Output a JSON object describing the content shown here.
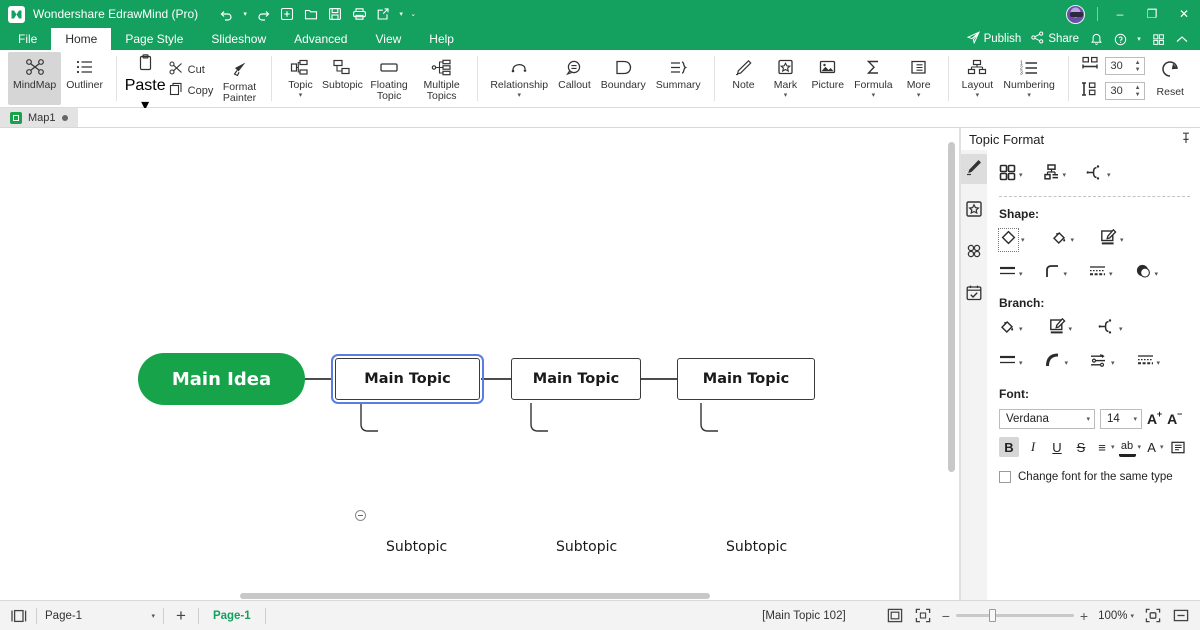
{
  "window": {
    "title": "Wondershare EdrawMind (Pro)",
    "logo_icon": "edrawmind-logo-icon",
    "quick_access": [
      {
        "name": "undo-icon",
        "glyph": "↶",
        "has_caret": true
      },
      {
        "name": "redo-icon",
        "glyph": "↷",
        "has_caret": false
      },
      {
        "name": "new-document-icon",
        "glyph": "⊞",
        "has_caret": false
      },
      {
        "name": "open-folder-icon",
        "glyph": "🗀",
        "has_caret": false
      },
      {
        "name": "save-icon",
        "glyph": "🖫",
        "has_caret": false
      },
      {
        "name": "print-icon",
        "glyph": "⎙",
        "has_caret": false
      },
      {
        "name": "export-icon",
        "glyph": "↗",
        "has_caret": true
      }
    ],
    "more_commands": "⌄",
    "minimize": "–",
    "maximize": "❐",
    "close": "✕"
  },
  "menubar": {
    "items": [
      {
        "label": "File",
        "active": false
      },
      {
        "label": "Home",
        "active": true
      },
      {
        "label": "Page Style",
        "active": false
      },
      {
        "label": "Slideshow",
        "active": false
      },
      {
        "label": "Advanced",
        "active": false
      },
      {
        "label": "View",
        "active": false
      },
      {
        "label": "Help",
        "active": false
      }
    ],
    "publish_label": "Publish",
    "share_label": "Share",
    "notification_icon": "bell-icon",
    "help_icon": "help-circle-icon",
    "apps_icon": "grid-apps-icon",
    "collapse_icon": "chevron-up-icon"
  },
  "ribbon": {
    "groups": [
      {
        "name": "view-group",
        "buttons": [
          {
            "label": "MindMap",
            "icon": "mindmap-icon",
            "selected": true,
            "caret": false
          },
          {
            "label": "Outliner",
            "icon": "outliner-icon",
            "selected": false,
            "caret": false
          }
        ]
      },
      {
        "name": "clipboard-group",
        "paste_label": "Paste",
        "paste_icon": "paste-icon",
        "cut_label": "Cut",
        "cut_icon": "scissors-icon",
        "copy_label": "Copy",
        "copy_icon": "copy-icon",
        "format_painter_label": "Format Painter",
        "format_painter_icon": "format-painter-icon"
      },
      {
        "name": "topic-group",
        "buttons": [
          {
            "label": "Topic",
            "icon": "topic-icon",
            "caret": true
          },
          {
            "label": "Subtopic",
            "icon": "subtopic-icon",
            "caret": false
          },
          {
            "label": "Floating Topic",
            "icon": "floating-topic-icon",
            "caret": false
          },
          {
            "label": "Multiple Topics",
            "icon": "multiple-topics-icon",
            "caret": false
          }
        ]
      },
      {
        "name": "annotation-group",
        "buttons": [
          {
            "label": "Relationship",
            "icon": "relationship-icon",
            "caret": true
          },
          {
            "label": "Callout",
            "icon": "callout-icon",
            "caret": false
          },
          {
            "label": "Boundary",
            "icon": "boundary-icon",
            "caret": false
          },
          {
            "label": "Summary",
            "icon": "summary-icon",
            "caret": false
          }
        ]
      },
      {
        "name": "insert-group",
        "buttons": [
          {
            "label": "Note",
            "icon": "note-pencil-icon",
            "caret": false
          },
          {
            "label": "Mark",
            "icon": "mark-badge-icon",
            "caret": true
          },
          {
            "label": "Picture",
            "icon": "picture-icon",
            "caret": false
          },
          {
            "label": "Formula",
            "icon": "formula-sigma-icon",
            "caret": true
          },
          {
            "label": "More",
            "icon": "more-list-icon",
            "caret": true
          }
        ]
      },
      {
        "name": "layout-group",
        "buttons": [
          {
            "label": "Layout",
            "icon": "layout-tree-icon",
            "caret": true
          },
          {
            "label": "Numbering",
            "icon": "numbering-icon",
            "caret": true
          }
        ]
      }
    ],
    "spacing": {
      "horizontal_icon": "horizontal-spacing-icon",
      "horizontal_value": "30",
      "vertical_icon": "vertical-spacing-icon",
      "vertical_value": "30",
      "reset_label": "Reset",
      "reset_icon": "reset-circular-arrow-icon"
    }
  },
  "doc_tab": {
    "name": "Map1",
    "file_icon": "mindmap-file-icon",
    "modified_dot": true
  },
  "canvas": {
    "root": {
      "label": "Main Idea",
      "color": "#16a34a"
    },
    "topics": [
      {
        "label": "Main Topic",
        "selected": true,
        "subtopic": "Subtopic",
        "has_collapse_handle": true
      },
      {
        "label": "Main Topic",
        "selected": false,
        "subtopic": "Subtopic",
        "has_collapse_handle": false
      },
      {
        "label": "Main Topic",
        "selected": false,
        "subtopic": "Subtopic",
        "has_collapse_handle": false
      }
    ],
    "selection_color": "#5b7ce0"
  },
  "right_panel": {
    "title": "Topic Format",
    "pin_icon": "pin-icon",
    "tabs": [
      {
        "name": "format-paint-tab",
        "icon": "paint-roller-icon",
        "active": true
      },
      {
        "name": "mark-tab",
        "icon": "badge-star-icon",
        "active": false
      },
      {
        "name": "clipart-tab",
        "icon": "clover-icon",
        "active": false
      },
      {
        "name": "task-tab",
        "icon": "checklist-calendar-icon",
        "active": false
      }
    ],
    "theme_icons": [
      {
        "name": "theme-grid-icon",
        "caret": true
      },
      {
        "name": "structure-icon",
        "caret": true
      },
      {
        "name": "branch-style-icon",
        "caret": true
      }
    ],
    "shape_section": {
      "label": "Shape:",
      "row1": [
        {
          "name": "shape-type-icon",
          "caret": true,
          "selected": true
        },
        {
          "name": "fill-color-icon",
          "caret": true,
          "selected": false
        },
        {
          "name": "border-edit-icon",
          "caret": true,
          "selected": false
        }
      ],
      "row2": [
        {
          "name": "line-weight-icon",
          "caret": true
        },
        {
          "name": "corner-radius-icon",
          "caret": true
        },
        {
          "name": "line-dash-icon",
          "caret": true
        },
        {
          "name": "shadow-icon",
          "caret": true
        }
      ]
    },
    "branch_section": {
      "label": "Branch:",
      "row1": [
        {
          "name": "branch-fill-icon",
          "caret": true
        },
        {
          "name": "branch-edit-icon",
          "caret": true
        },
        {
          "name": "branch-connector-icon",
          "caret": true
        }
      ],
      "row2": [
        {
          "name": "branch-weight-icon",
          "caret": true
        },
        {
          "name": "branch-curve-icon",
          "caret": true
        },
        {
          "name": "branch-arrow-icon",
          "caret": true
        },
        {
          "name": "branch-dash-icon",
          "caret": true
        }
      ]
    },
    "font_section": {
      "label": "Font:",
      "family": "Verdana",
      "size": "14",
      "increase_label": "A",
      "increase_sup": "+",
      "decrease_label": "A",
      "decrease_sup": "−",
      "buttons": [
        {
          "name": "bold-button",
          "glyph": "B",
          "active": true,
          "caret": false
        },
        {
          "name": "italic-button",
          "glyph": "I",
          "active": false,
          "caret": false
        },
        {
          "name": "underline-button",
          "glyph": "U",
          "active": false,
          "caret": false
        },
        {
          "name": "strikethrough-button",
          "glyph": "S",
          "active": false,
          "caret": false
        },
        {
          "name": "align-button",
          "glyph": "≡",
          "active": false,
          "caret": true
        },
        {
          "name": "highlight-button",
          "glyph": "ab",
          "active": false,
          "caret": true
        },
        {
          "name": "font-color-button",
          "glyph": "A",
          "active": false,
          "caret": true
        },
        {
          "name": "text-direction-button",
          "glyph": "▤",
          "active": false,
          "caret": false
        }
      ],
      "checkbox_label": "Change font for the same type",
      "checkbox_checked": false
    }
  },
  "statusbar": {
    "panel_toggle_icon": "panel-toggle-icon",
    "page_select_value": "Page-1",
    "add_page_label": "+",
    "page_tab_label": "Page-1",
    "selection_text": "[Main Topic 102]",
    "fit_page_icon": "fit-page-icon",
    "fullscreen_icon": "fullscreen-icon",
    "zoom_out": "−",
    "zoom_in": "+",
    "zoom_level": "100%",
    "focus_icon": "focus-mode-icon",
    "collapse_icon": "collapse-panel-icon"
  }
}
